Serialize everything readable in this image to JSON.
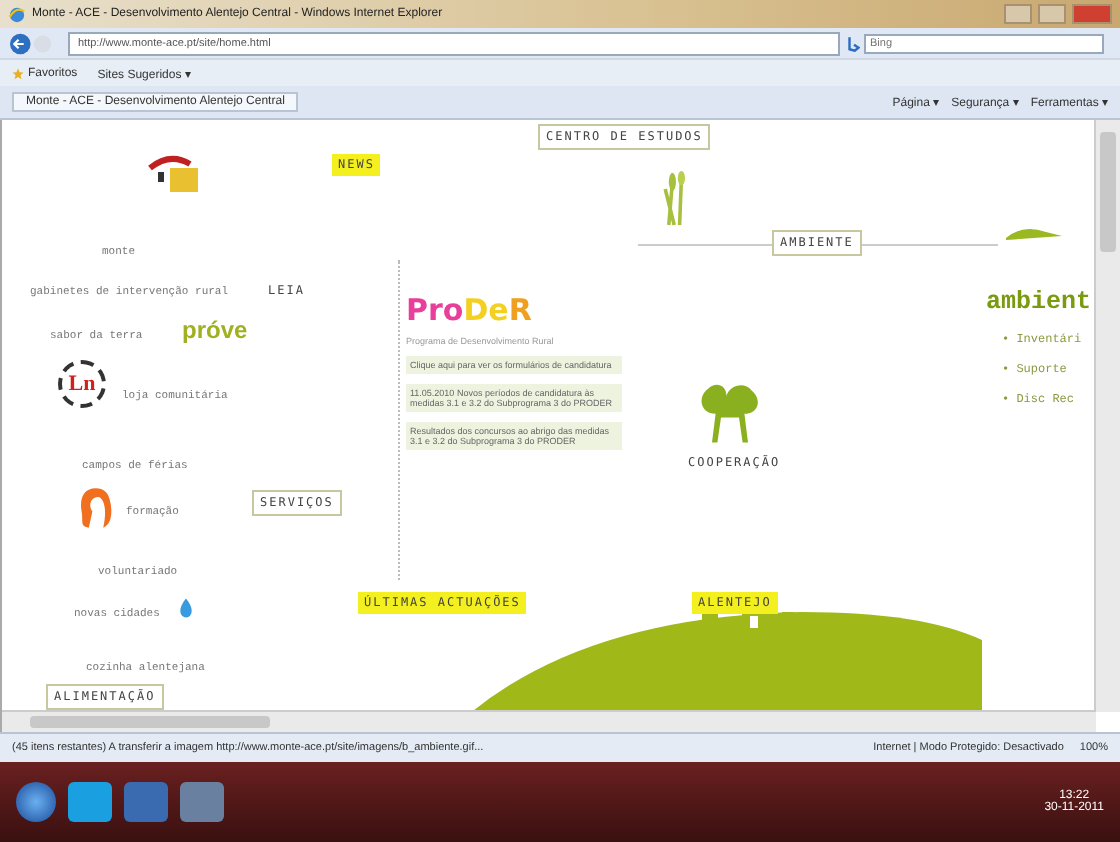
{
  "window": {
    "title": "Monte - ACE - Desenvolvimento Alentejo Central - Windows Internet Explorer"
  },
  "address_bar": {
    "url": "http://www.monte-ace.pt/site/home.html",
    "search_placeholder": "Bing"
  },
  "favorites_bar": {
    "favorites": "Favoritos",
    "suggested": "Sites Sugeridos ▾"
  },
  "tab": {
    "title": "Monte - ACE - Desenvolvimento Alentejo Central"
  },
  "command_bar": [
    "Página ▾",
    "Segurança ▾",
    "Ferramentas ▾"
  ],
  "menu": [
    {
      "label": "monte",
      "kind": "text"
    },
    {
      "label": "gabinetes de intervenção rural",
      "kind": "text"
    },
    {
      "label": "sabor da terra",
      "kind": "prove"
    },
    {
      "label": "loja comunitária",
      "kind": "loja"
    },
    {
      "label": "campos de férias",
      "kind": "text"
    },
    {
      "label": "formação",
      "kind": "head"
    },
    {
      "label": "voluntariado",
      "kind": "text"
    },
    {
      "label": "novas cidades",
      "kind": "drop"
    },
    {
      "label": "cozinha alentejana",
      "kind": "text"
    }
  ],
  "prove_logo": "próve",
  "loja_logo": "Ln",
  "tags": [
    {
      "text": "NEWS",
      "kind": "highlight"
    },
    {
      "text": "CENTRO DE ESTUDOS",
      "kind": "boxed"
    },
    {
      "text": "LEIA",
      "kind": "plain"
    },
    {
      "text": "SERVIÇOS",
      "kind": "boxed"
    },
    {
      "text": "ÚLTIMAS ACTUAÇÕES",
      "kind": "highlight"
    },
    {
      "text": "ALENTEJO",
      "kind": "highlight"
    },
    {
      "text": "AMBIENTE",
      "kind": "boxed"
    },
    {
      "text": "COOPERAÇÃO",
      "kind": "plain"
    },
    {
      "text": "ALIMENTAÇÃO",
      "kind": "boxed"
    }
  ],
  "proder": {
    "logo": [
      {
        "text": "Pro",
        "color": "#e8409a"
      },
      {
        "text": "De",
        "color": "#f4d020"
      },
      {
        "text": "R",
        "color": "#f0a020"
      }
    ],
    "subtitle": "Programa de Desenvolvimento Rural",
    "notices": [
      "Clique aqui para ver os formulários de candidatura",
      "11.05.2010 Novos períodos de candidatura às medidas 3.1 e 3.2 do Subprograma 3 do PRODER",
      "Resultados dos concursos ao abrigo das medidas 3.1 e 3.2 do Subprograma 3 do PRODER"
    ]
  },
  "ambiente_panel": {
    "heading": "ambient",
    "links": [
      "• Inventári",
      "• Suporte",
      "• Disc Rec"
    ]
  },
  "status_bar": {
    "message": "(45 itens restantes) A transferir a imagem http://www.monte-ace.pt/site/imagens/b_ambiente.gif...",
    "zone": "Internet | Modo Protegido: Desactivado",
    "zoom": "100%"
  },
  "taskbar": {
    "time": "13:22",
    "date": "30-11-2011"
  }
}
